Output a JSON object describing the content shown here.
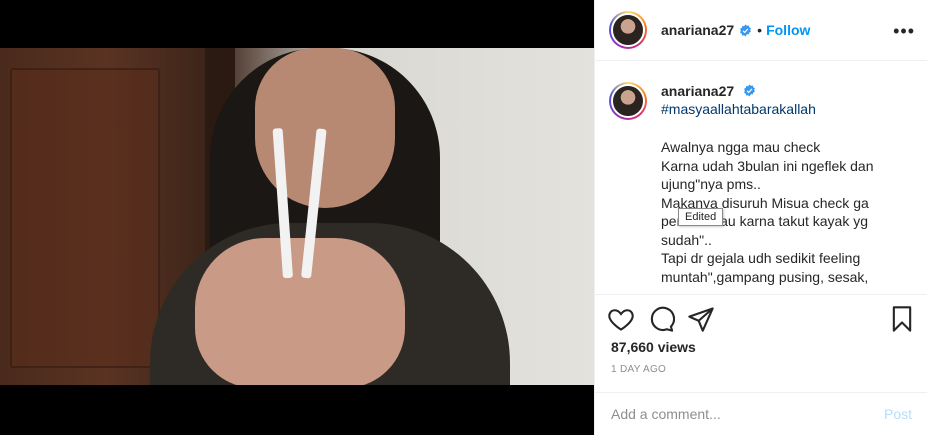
{
  "post": {
    "username": "anariana27",
    "follow_label": "Follow",
    "separator": "•",
    "more_label": "•••"
  },
  "caption": {
    "username": "anariana27",
    "hashtag": "#masyaallahtabarakallah",
    "body": "Awalnya ngga mau check\nKarna udah 3bulan ini ngeflek dan ujung\"nya pms..\nMakanya disuruh Misua check ga pernah mau karna takut kayak yg sudah\"..\nTapi dr gejala udh sedikit feeling muntah\",gampang pusing, sesak,",
    "tooltip": "Edited"
  },
  "stats": {
    "views": "87,660 views",
    "time": "1 DAY AGO"
  },
  "comment": {
    "placeholder": "Add a comment...",
    "post_label": "Post"
  },
  "icons": {
    "verified": "verified-badge-icon",
    "like": "heart-icon",
    "comment": "comment-bubble-icon",
    "share": "paper-plane-icon",
    "save": "bookmark-icon",
    "user_tag": "user-icon"
  },
  "colors": {
    "accent": "#0095f6",
    "text": "#262626",
    "muted": "#8e8e8e",
    "hashtag": "#00376b",
    "post_disabled": "#b2dffc"
  }
}
